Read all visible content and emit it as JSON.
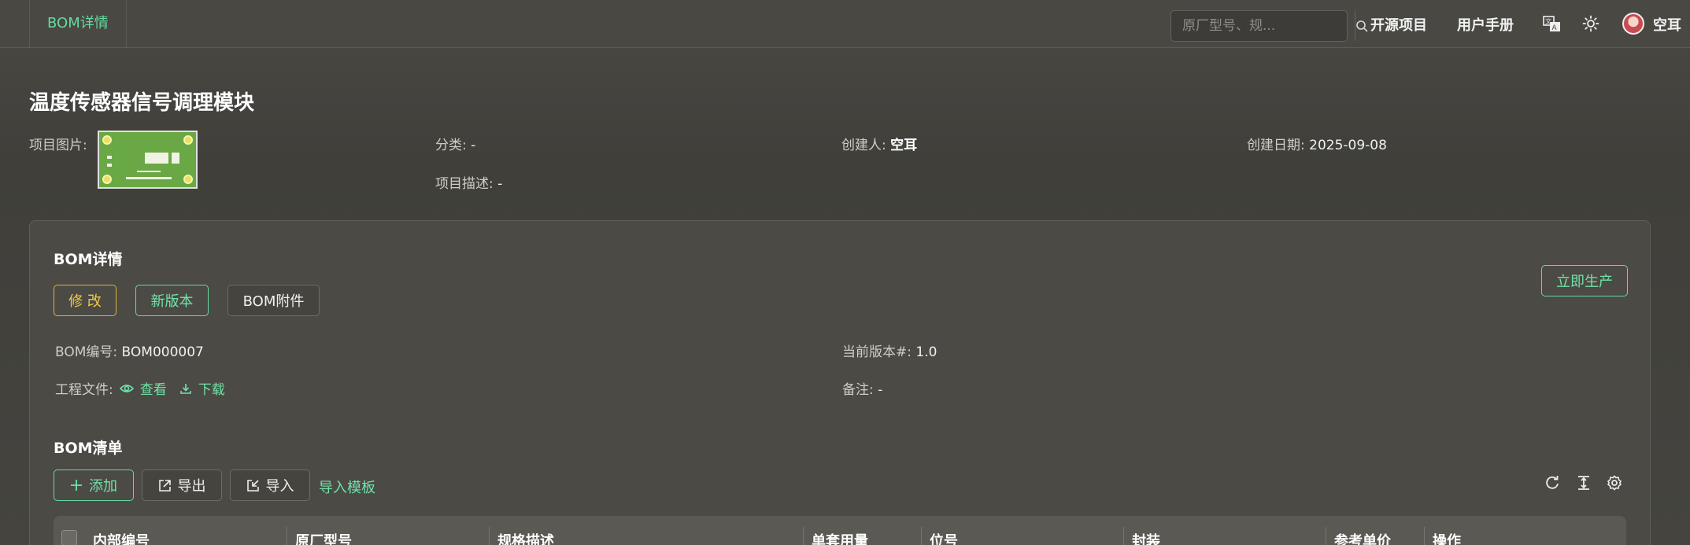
{
  "topbar": {
    "active_tab": "BOM详情",
    "search_placeholder": "原厂型号、规...",
    "nav_open_source": "开源项目",
    "nav_manual": "用户手册",
    "user_name": "空耳"
  },
  "project": {
    "title": "温度传感器信号调理模块",
    "image_label": "项目图片:",
    "category_label": "分类:",
    "category_value": "-",
    "creator_label": "创建人:",
    "creator_value": "空耳",
    "created_label": "创建日期:",
    "created_value": "2025-09-08",
    "desc_label": "项目描述:",
    "desc_value": "-"
  },
  "bom": {
    "section_title": "BOM详情",
    "edit_label": "修 改",
    "new_version_label": "新版本",
    "attachment_label": "BOM附件",
    "produce_label": "立即生产",
    "number_label": "BOM编号:",
    "number_value": "BOM000007",
    "version_label": "当前版本#:",
    "version_value": "1.0",
    "files_label": "工程文件:",
    "view_label": "查看",
    "download_label": "下载",
    "remark_label": "备注:",
    "remark_value": "-"
  },
  "bom_list": {
    "section_title": "BOM清单",
    "add_label": "添加",
    "export_label": "导出",
    "import_label": "导入",
    "template_label": "导入模板",
    "columns": [
      "内部编号",
      "原厂型号",
      "规格描述",
      "单套用量",
      "位号",
      "封装",
      "参考单价",
      "操作"
    ]
  },
  "colors": {
    "accent_green": "#64dba0",
    "warn_yellow": "#e0b23e",
    "background": "#45443f"
  }
}
